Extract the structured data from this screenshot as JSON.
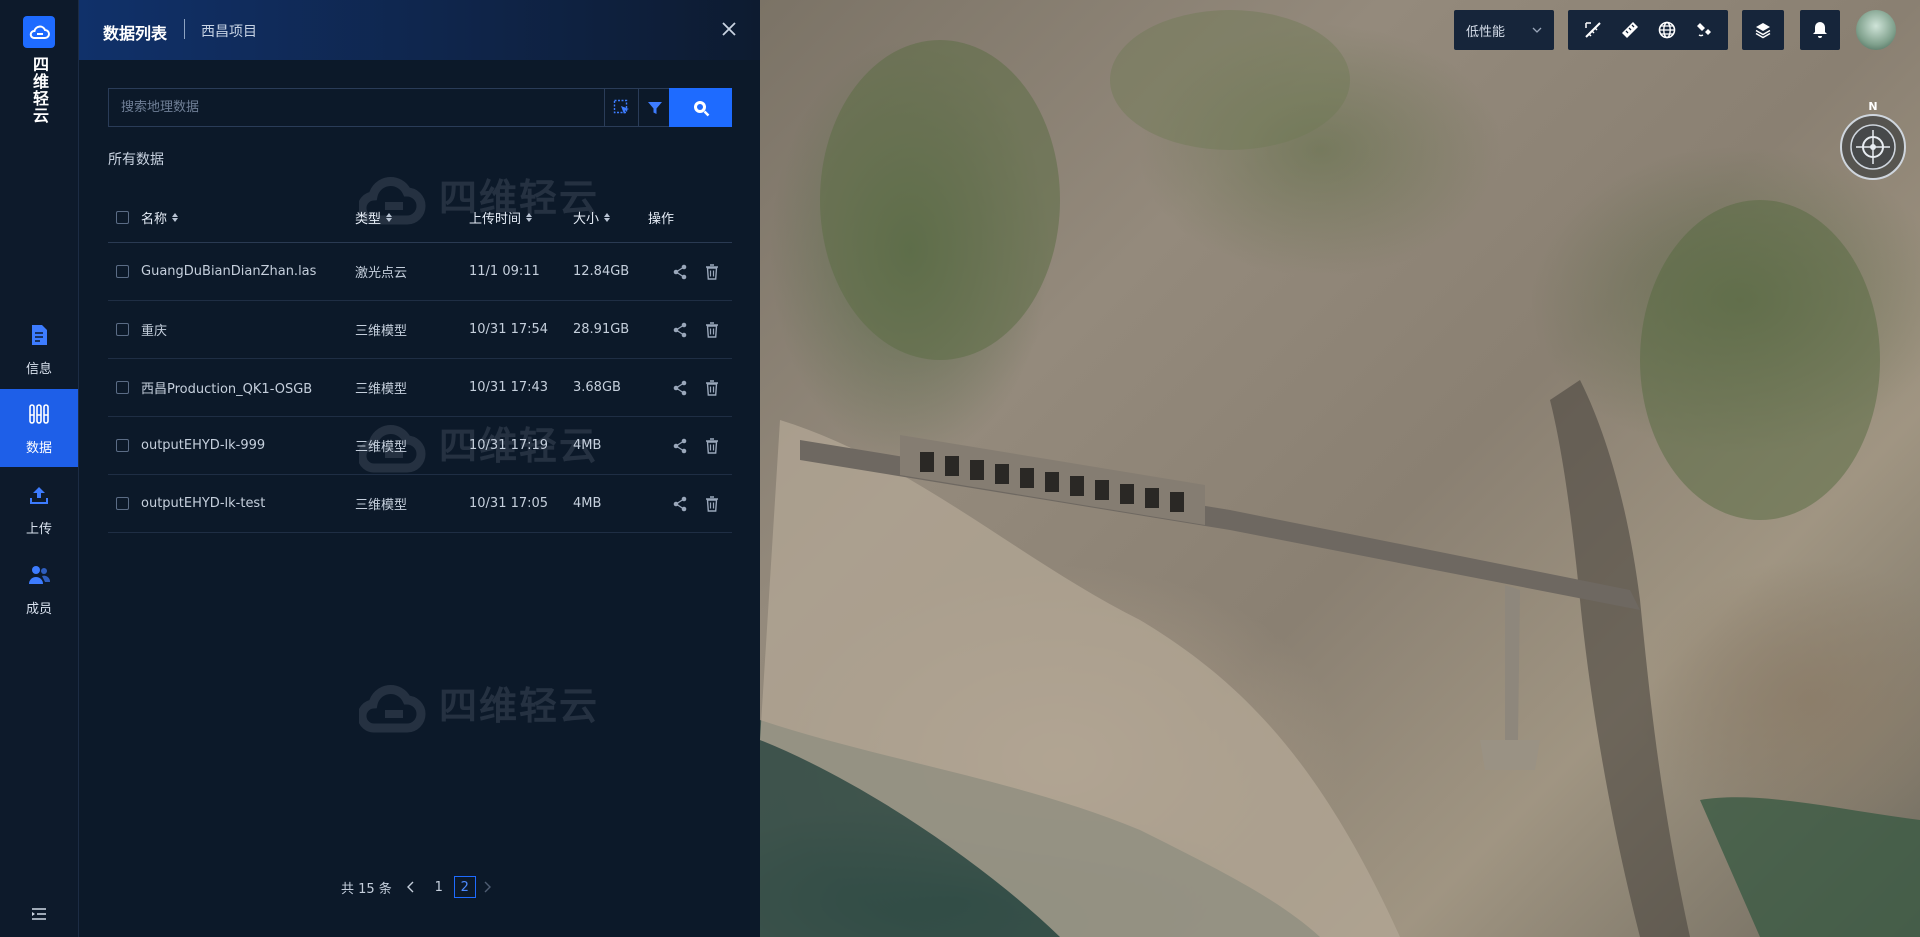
{
  "app": {
    "name": "四维轻云"
  },
  "nav": {
    "items": [
      {
        "id": "info",
        "label": "信息",
        "active": false,
        "icon": "document-icon"
      },
      {
        "id": "data",
        "label": "数据",
        "active": true,
        "icon": "database-icon"
      },
      {
        "id": "upload",
        "label": "上传",
        "active": false,
        "icon": "upload-icon"
      },
      {
        "id": "members",
        "label": "成员",
        "active": false,
        "icon": "members-icon"
      }
    ],
    "collapse_icon": "menu-collapse-icon"
  },
  "panel": {
    "title": "数据列表",
    "project": "西昌项目",
    "search": {
      "placeholder": "搜索地理数据",
      "value": ""
    },
    "section_label": "所有数据",
    "watermark": "四维轻云",
    "columns": [
      "名称",
      "类型",
      "上传时间",
      "大小",
      "操作"
    ],
    "rows": [
      {
        "name": "GuangDuBianDianZhan.las",
        "type": "激光点云",
        "time": "11/1 09:11",
        "size": "12.84GB"
      },
      {
        "name": "重庆",
        "type": "三维模型",
        "time": "10/31 17:54",
        "size": "28.91GB"
      },
      {
        "name": "西昌Production_QK1-OSGB",
        "type": "三维模型",
        "time": "10/31 17:43",
        "size": "3.68GB"
      },
      {
        "name": "outputEHYD-lk-999",
        "type": "三维模型",
        "time": "10/31 17:19",
        "size": "4MB"
      },
      {
        "name": "outputEHYD-lk-test",
        "type": "三维模型",
        "time": "10/31 17:05",
        "size": "4MB"
      }
    ],
    "pagination": {
      "total": "共 15 条",
      "pages": [
        "1",
        "2"
      ],
      "current": "2"
    }
  },
  "map": {
    "performance": "低性能",
    "tools": [
      "measure-icon",
      "ruler-icon",
      "globe-icon",
      "satellite-icon"
    ],
    "layers_icon": "layers-icon",
    "bell_icon": "bell-icon",
    "compass_label": "N"
  },
  "colors": {
    "accent": "#1e6bff",
    "panel_bg": "#0c1929",
    "nav_bg": "#0d1a2b"
  }
}
